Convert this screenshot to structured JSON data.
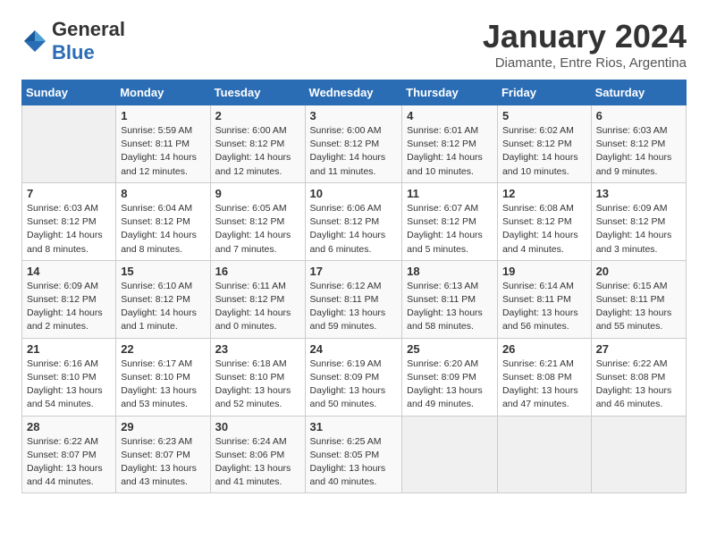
{
  "header": {
    "logo_general": "General",
    "logo_blue": "Blue",
    "month_title": "January 2024",
    "subtitle": "Diamante, Entre Rios, Argentina"
  },
  "weekdays": [
    "Sunday",
    "Monday",
    "Tuesday",
    "Wednesday",
    "Thursday",
    "Friday",
    "Saturday"
  ],
  "weeks": [
    [
      {
        "day": "",
        "empty": true
      },
      {
        "day": "1",
        "sunrise": "Sunrise: 5:59 AM",
        "sunset": "Sunset: 8:11 PM",
        "daylight": "Daylight: 14 hours and 12 minutes."
      },
      {
        "day": "2",
        "sunrise": "Sunrise: 6:00 AM",
        "sunset": "Sunset: 8:12 PM",
        "daylight": "Daylight: 14 hours and 12 minutes."
      },
      {
        "day": "3",
        "sunrise": "Sunrise: 6:00 AM",
        "sunset": "Sunset: 8:12 PM",
        "daylight": "Daylight: 14 hours and 11 minutes."
      },
      {
        "day": "4",
        "sunrise": "Sunrise: 6:01 AM",
        "sunset": "Sunset: 8:12 PM",
        "daylight": "Daylight: 14 hours and 10 minutes."
      },
      {
        "day": "5",
        "sunrise": "Sunrise: 6:02 AM",
        "sunset": "Sunset: 8:12 PM",
        "daylight": "Daylight: 14 hours and 10 minutes."
      },
      {
        "day": "6",
        "sunrise": "Sunrise: 6:03 AM",
        "sunset": "Sunset: 8:12 PM",
        "daylight": "Daylight: 14 hours and 9 minutes."
      }
    ],
    [
      {
        "day": "7",
        "sunrise": "Sunrise: 6:03 AM",
        "sunset": "Sunset: 8:12 PM",
        "daylight": "Daylight: 14 hours and 8 minutes."
      },
      {
        "day": "8",
        "sunrise": "Sunrise: 6:04 AM",
        "sunset": "Sunset: 8:12 PM",
        "daylight": "Daylight: 14 hours and 8 minutes."
      },
      {
        "day": "9",
        "sunrise": "Sunrise: 6:05 AM",
        "sunset": "Sunset: 8:12 PM",
        "daylight": "Daylight: 14 hours and 7 minutes."
      },
      {
        "day": "10",
        "sunrise": "Sunrise: 6:06 AM",
        "sunset": "Sunset: 8:12 PM",
        "daylight": "Daylight: 14 hours and 6 minutes."
      },
      {
        "day": "11",
        "sunrise": "Sunrise: 6:07 AM",
        "sunset": "Sunset: 8:12 PM",
        "daylight": "Daylight: 14 hours and 5 minutes."
      },
      {
        "day": "12",
        "sunrise": "Sunrise: 6:08 AM",
        "sunset": "Sunset: 8:12 PM",
        "daylight": "Daylight: 14 hours and 4 minutes."
      },
      {
        "day": "13",
        "sunrise": "Sunrise: 6:09 AM",
        "sunset": "Sunset: 8:12 PM",
        "daylight": "Daylight: 14 hours and 3 minutes."
      }
    ],
    [
      {
        "day": "14",
        "sunrise": "Sunrise: 6:09 AM",
        "sunset": "Sunset: 8:12 PM",
        "daylight": "Daylight: 14 hours and 2 minutes."
      },
      {
        "day": "15",
        "sunrise": "Sunrise: 6:10 AM",
        "sunset": "Sunset: 8:12 PM",
        "daylight": "Daylight: 14 hours and 1 minute."
      },
      {
        "day": "16",
        "sunrise": "Sunrise: 6:11 AM",
        "sunset": "Sunset: 8:12 PM",
        "daylight": "Daylight: 14 hours and 0 minutes."
      },
      {
        "day": "17",
        "sunrise": "Sunrise: 6:12 AM",
        "sunset": "Sunset: 8:11 PM",
        "daylight": "Daylight: 13 hours and 59 minutes."
      },
      {
        "day": "18",
        "sunrise": "Sunrise: 6:13 AM",
        "sunset": "Sunset: 8:11 PM",
        "daylight": "Daylight: 13 hours and 58 minutes."
      },
      {
        "day": "19",
        "sunrise": "Sunrise: 6:14 AM",
        "sunset": "Sunset: 8:11 PM",
        "daylight": "Daylight: 13 hours and 56 minutes."
      },
      {
        "day": "20",
        "sunrise": "Sunrise: 6:15 AM",
        "sunset": "Sunset: 8:11 PM",
        "daylight": "Daylight: 13 hours and 55 minutes."
      }
    ],
    [
      {
        "day": "21",
        "sunrise": "Sunrise: 6:16 AM",
        "sunset": "Sunset: 8:10 PM",
        "daylight": "Daylight: 13 hours and 54 minutes."
      },
      {
        "day": "22",
        "sunrise": "Sunrise: 6:17 AM",
        "sunset": "Sunset: 8:10 PM",
        "daylight": "Daylight: 13 hours and 53 minutes."
      },
      {
        "day": "23",
        "sunrise": "Sunrise: 6:18 AM",
        "sunset": "Sunset: 8:10 PM",
        "daylight": "Daylight: 13 hours and 52 minutes."
      },
      {
        "day": "24",
        "sunrise": "Sunrise: 6:19 AM",
        "sunset": "Sunset: 8:09 PM",
        "daylight": "Daylight: 13 hours and 50 minutes."
      },
      {
        "day": "25",
        "sunrise": "Sunrise: 6:20 AM",
        "sunset": "Sunset: 8:09 PM",
        "daylight": "Daylight: 13 hours and 49 minutes."
      },
      {
        "day": "26",
        "sunrise": "Sunrise: 6:21 AM",
        "sunset": "Sunset: 8:08 PM",
        "daylight": "Daylight: 13 hours and 47 minutes."
      },
      {
        "day": "27",
        "sunrise": "Sunrise: 6:22 AM",
        "sunset": "Sunset: 8:08 PM",
        "daylight": "Daylight: 13 hours and 46 minutes."
      }
    ],
    [
      {
        "day": "28",
        "sunrise": "Sunrise: 6:22 AM",
        "sunset": "Sunset: 8:07 PM",
        "daylight": "Daylight: 13 hours and 44 minutes."
      },
      {
        "day": "29",
        "sunrise": "Sunrise: 6:23 AM",
        "sunset": "Sunset: 8:07 PM",
        "daylight": "Daylight: 13 hours and 43 minutes."
      },
      {
        "day": "30",
        "sunrise": "Sunrise: 6:24 AM",
        "sunset": "Sunset: 8:06 PM",
        "daylight": "Daylight: 13 hours and 41 minutes."
      },
      {
        "day": "31",
        "sunrise": "Sunrise: 6:25 AM",
        "sunset": "Sunset: 8:05 PM",
        "daylight": "Daylight: 13 hours and 40 minutes."
      },
      {
        "day": "",
        "empty": true
      },
      {
        "day": "",
        "empty": true
      },
      {
        "day": "",
        "empty": true
      }
    ]
  ]
}
